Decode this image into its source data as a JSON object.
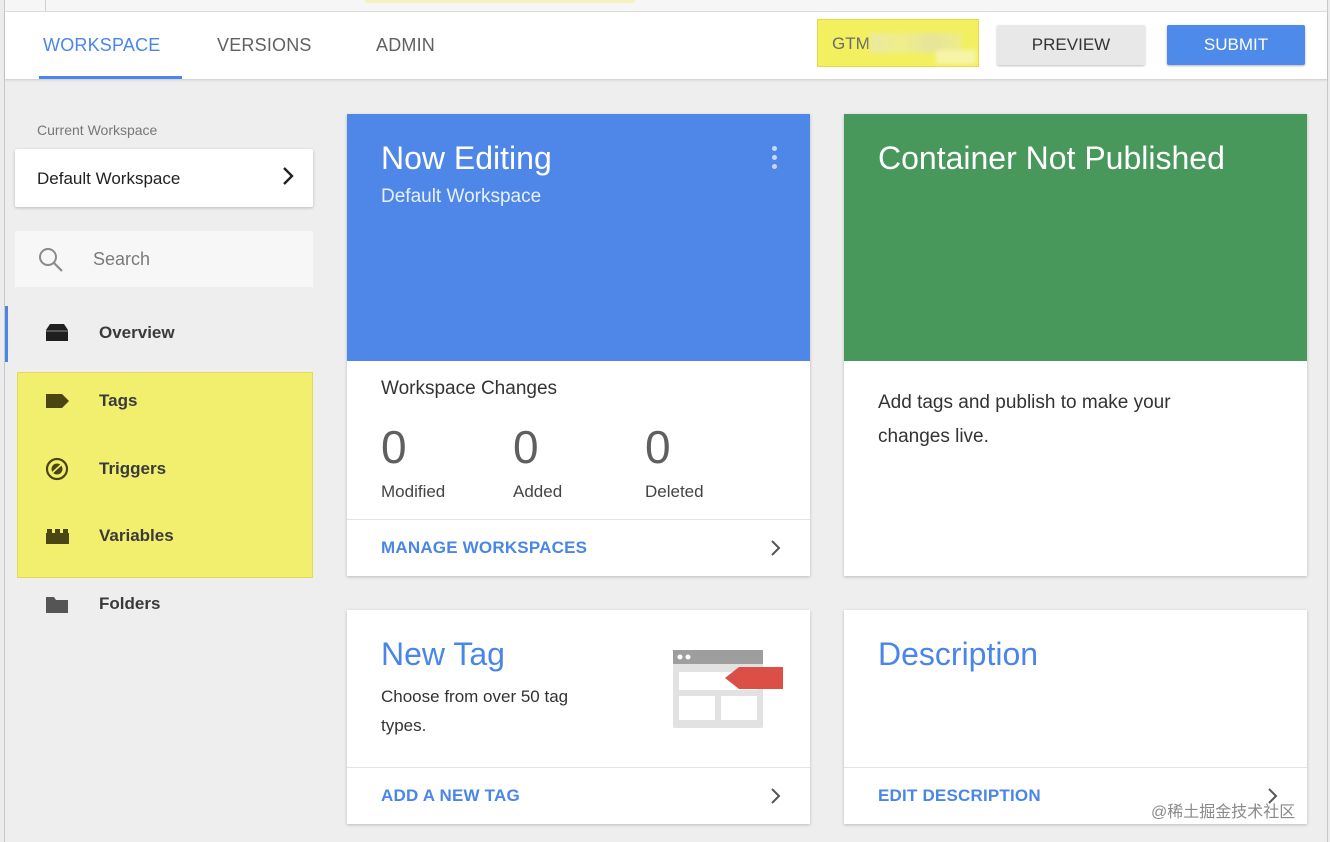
{
  "nav": {
    "tabs": [
      {
        "label": "WORKSPACE",
        "active": true
      },
      {
        "label": "VERSIONS",
        "active": false
      },
      {
        "label": "ADMIN",
        "active": false
      }
    ],
    "container_id_visible": "GTM",
    "preview_label": "PREVIEW",
    "submit_label": "SUBMIT"
  },
  "sidebar": {
    "current_workspace_label": "Current Workspace",
    "workspace_name": "Default Workspace",
    "search_placeholder": "Search",
    "items": [
      {
        "label": "Overview",
        "icon": "overview-icon",
        "selected": true
      },
      {
        "label": "Tags",
        "icon": "tag-icon",
        "highlighted": true
      },
      {
        "label": "Triggers",
        "icon": "trigger-icon",
        "highlighted": true
      },
      {
        "label": "Variables",
        "icon": "variables-icon",
        "highlighted": true
      },
      {
        "label": "Folders",
        "icon": "folder-icon"
      }
    ]
  },
  "editing_card": {
    "title": "Now Editing",
    "subtitle": "Default Workspace",
    "changes_title": "Workspace Changes",
    "stats": [
      {
        "value": "0",
        "label": "Modified"
      },
      {
        "value": "0",
        "label": "Added"
      },
      {
        "value": "0",
        "label": "Deleted"
      }
    ],
    "link": "MANAGE WORKSPACES"
  },
  "publish_card": {
    "title": "Container Not Published",
    "message": "Add tags and publish to make your changes live."
  },
  "new_tag_card": {
    "title": "New Tag",
    "description": "Choose from over 50 tag types.",
    "link": "ADD A NEW TAG"
  },
  "description_card": {
    "title": "Description",
    "link": "EDIT DESCRIPTION"
  },
  "watermark": "@稀土掘金技术社区",
  "colors": {
    "accent": "#4a86e8",
    "editing_header": "#4f87e9",
    "publish_header": "#48985c",
    "highlight": "#f2ee6e",
    "tag_red": "#db4f47"
  }
}
